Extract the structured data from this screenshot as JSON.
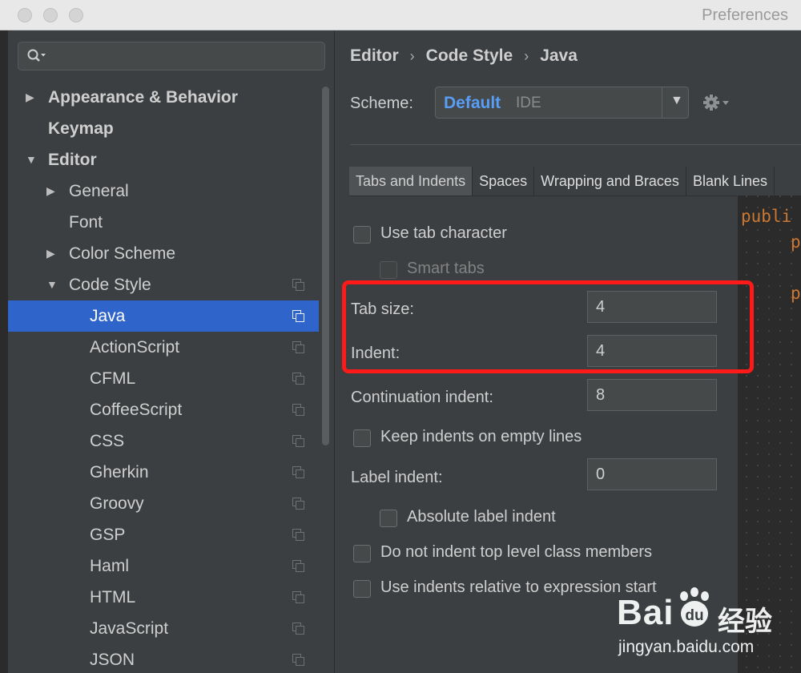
{
  "window": {
    "title": "Preferences"
  },
  "sidebar": {
    "search_placeholder": "",
    "items": [
      {
        "label": "Appearance & Behavior",
        "bold": true,
        "arrow": "▶",
        "level": 0
      },
      {
        "label": "Keymap",
        "bold": true,
        "arrow": "",
        "level": 0
      },
      {
        "label": "Editor",
        "bold": true,
        "arrow": "▼",
        "level": 0
      },
      {
        "label": "General",
        "arrow": "▶",
        "level": 1
      },
      {
        "label": "Font",
        "arrow": "",
        "level": 1
      },
      {
        "label": "Color Scheme",
        "arrow": "▶",
        "level": 1
      },
      {
        "label": "Code Style",
        "arrow": "▼",
        "level": 1,
        "copy_icon": true
      },
      {
        "label": "Java",
        "level": 2,
        "selected": true,
        "copy_icon": true
      },
      {
        "label": "ActionScript",
        "level": 2,
        "copy_icon": true
      },
      {
        "label": "CFML",
        "level": 2,
        "copy_icon": true
      },
      {
        "label": "CoffeeScript",
        "level": 2,
        "copy_icon": true
      },
      {
        "label": "CSS",
        "level": 2,
        "copy_icon": true
      },
      {
        "label": "Gherkin",
        "level": 2,
        "copy_icon": true
      },
      {
        "label": "Groovy",
        "level": 2,
        "copy_icon": true
      },
      {
        "label": "GSP",
        "level": 2,
        "copy_icon": true
      },
      {
        "label": "Haml",
        "level": 2,
        "copy_icon": true
      },
      {
        "label": "HTML",
        "level": 2,
        "copy_icon": true
      },
      {
        "label": "JavaScript",
        "level": 2,
        "copy_icon": true
      },
      {
        "label": "JSON",
        "level": 2,
        "copy_icon": true
      }
    ]
  },
  "breadcrumb": {
    "items": [
      "Editor",
      "Code Style",
      "Java"
    ],
    "separator": "›"
  },
  "scheme": {
    "label": "Scheme:",
    "name": "Default",
    "tag": "IDE",
    "caret": "▼"
  },
  "tabs": [
    "Tabs and Indents",
    "Spaces",
    "Wrapping and Braces",
    "Blank Lines"
  ],
  "options": {
    "use_tab_character": "Use tab character",
    "smart_tabs": "Smart tabs",
    "tab_size_label": "Tab size:",
    "tab_size_value": "4",
    "indent_label": "Indent:",
    "indent_value": "4",
    "continuation_label": "Continuation indent:",
    "continuation_value": "8",
    "keep_indents": "Keep indents on empty lines",
    "label_indent_label": "Label indent:",
    "label_indent_value": "0",
    "absolute_label_indent": "Absolute label indent",
    "no_indent_top_level": "Do not indent top level class members",
    "relative_indents": "Use indents relative to expression start"
  },
  "code_preview": {
    "lines": [
      "publi",
      "p",
      "p"
    ]
  },
  "watermark": {
    "brand": "Bai",
    "paw": "du",
    "cn": "经验",
    "url": "jingyan.baidu.com"
  },
  "colors": {
    "accent": "#2f65ca",
    "scheme_name": "#589df6",
    "highlight": "#ff1a1a",
    "keyword": "#cc7832"
  }
}
